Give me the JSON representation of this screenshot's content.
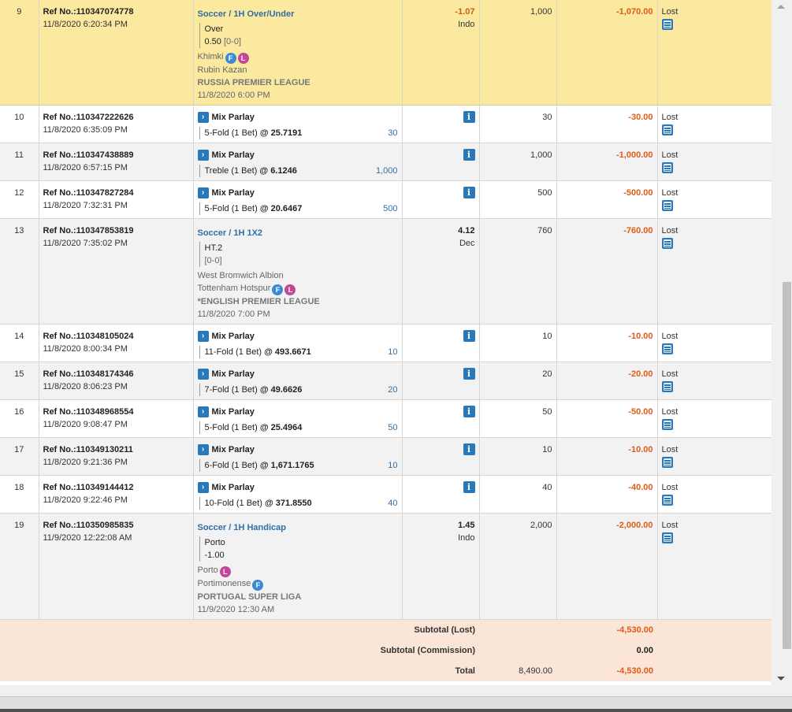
{
  "rows": [
    {
      "no": "9",
      "ref": "Ref No.:110347074778",
      "datetime": "11/8/2020 6:20:34 PM",
      "type": "single",
      "sport": "Soccer / 1H Over/Under",
      "selection": "Over",
      "line": "0.50",
      "score": "[0-0]",
      "home": "Khimki",
      "home_badges": [
        "F",
        "L"
      ],
      "away": "Rubin Kazan",
      "away_badges": [],
      "league": "RUSSIA PREMIER LEAGUE",
      "match_date": "11/8/2020 6:00 PM",
      "odds": "-1.07",
      "odds_type": "Indo",
      "stake": "1,000",
      "winloss": "-1,070.00",
      "status": "Lost",
      "highlight": true
    },
    {
      "no": "10",
      "ref": "Ref No.:110347222626",
      "datetime": "11/8/2020 6:35:09 PM",
      "type": "parlay",
      "parlay_title": "Mix Parlay",
      "fold": "5-Fold (1 Bet)",
      "at": "@ 25.7191",
      "parlay_stake": "30",
      "stake": "30",
      "winloss": "-30.00",
      "status": "Lost"
    },
    {
      "no": "11",
      "ref": "Ref No.:110347438889",
      "datetime": "11/8/2020 6:57:15 PM",
      "type": "parlay",
      "parlay_title": "Mix Parlay",
      "fold": "Treble (1 Bet)",
      "at": "@ 6.1246",
      "parlay_stake": "1,000",
      "stake": "1,000",
      "winloss": "-1,000.00",
      "status": "Lost"
    },
    {
      "no": "12",
      "ref": "Ref No.:110347827284",
      "datetime": "11/8/2020 7:32:31 PM",
      "type": "parlay",
      "parlay_title": "Mix Parlay",
      "fold": "5-Fold (1 Bet)",
      "at": "@ 20.6467",
      "parlay_stake": "500",
      "stake": "500",
      "winloss": "-500.00",
      "status": "Lost"
    },
    {
      "no": "13",
      "ref": "Ref No.:110347853819",
      "datetime": "11/8/2020 7:35:02 PM",
      "type": "single",
      "sport": "Soccer / 1H 1X2",
      "selection": "HT.2",
      "line": "",
      "score": "[0-0]",
      "home": "West Bromwich Albion",
      "home_badges": [],
      "away": "Tottenham Hotspur",
      "away_badges": [
        "F",
        "L"
      ],
      "league": "*ENGLISH PREMIER LEAGUE",
      "match_date": "11/8/2020 7:00 PM",
      "odds": "4.12",
      "odds_type": "Dec",
      "stake": "760",
      "winloss": "-760.00",
      "status": "Lost"
    },
    {
      "no": "14",
      "ref": "Ref No.:110348105024",
      "datetime": "11/8/2020 8:00:34 PM",
      "type": "parlay",
      "parlay_title": "Mix Parlay",
      "fold": "11-Fold (1 Bet)",
      "at": "@ 493.6671",
      "parlay_stake": "10",
      "stake": "10",
      "winloss": "-10.00",
      "status": "Lost"
    },
    {
      "no": "15",
      "ref": "Ref No.:110348174346",
      "datetime": "11/8/2020 8:06:23 PM",
      "type": "parlay",
      "parlay_title": "Mix Parlay",
      "fold": "7-Fold (1 Bet)",
      "at": "@ 49.6626",
      "parlay_stake": "20",
      "stake": "20",
      "winloss": "-20.00",
      "status": "Lost"
    },
    {
      "no": "16",
      "ref": "Ref No.:110348968554",
      "datetime": "11/8/2020 9:08:47 PM",
      "type": "parlay",
      "parlay_title": "Mix Parlay",
      "fold": "5-Fold (1 Bet)",
      "at": "@ 25.4964",
      "parlay_stake": "50",
      "stake": "50",
      "winloss": "-50.00",
      "status": "Lost"
    },
    {
      "no": "17",
      "ref": "Ref No.:110349130211",
      "datetime": "11/8/2020 9:21:36 PM",
      "type": "parlay",
      "parlay_title": "Mix Parlay",
      "fold": "6-Fold (1 Bet)",
      "at": "@ 1,671.1765",
      "parlay_stake": "10",
      "stake": "10",
      "winloss": "-10.00",
      "status": "Lost"
    },
    {
      "no": "18",
      "ref": "Ref No.:110349144412",
      "datetime": "11/8/2020 9:22:46 PM",
      "type": "parlay",
      "parlay_title": "Mix Parlay",
      "fold": "10-Fold (1 Bet)",
      "at": "@ 371.8550",
      "parlay_stake": "40",
      "stake": "40",
      "winloss": "-40.00",
      "status": "Lost"
    },
    {
      "no": "19",
      "ref": "Ref No.:110350985835",
      "datetime": "11/9/2020 12:22:08 AM",
      "type": "single",
      "sport": "Soccer / 1H Handicap",
      "selection": "Porto",
      "line": "-1.00",
      "score": "",
      "home": "Porto",
      "home_badges": [
        "L"
      ],
      "away": "Portimonense",
      "away_badges": [
        "F"
      ],
      "league": "PORTUGAL SUPER LIGA",
      "match_date": "11/9/2020 12:30 AM",
      "odds": "1.45",
      "odds_type": "Indo",
      "stake": "2,000",
      "winloss": "-2,000.00",
      "status": "Lost"
    }
  ],
  "summary": {
    "subtotal_lost_label": "Subtotal (Lost)",
    "subtotal_lost_value": "-4,530.00",
    "subtotal_commission_label": "Subtotal (Commission)",
    "subtotal_commission_value": "0.00",
    "total_label": "Total",
    "total_stake": "8,490.00",
    "total_value": "-4,530.00"
  },
  "icons": {
    "info": "info-icon",
    "receipt": "receipt-icon",
    "expand": "chevron-right-icon",
    "badge_f": "F",
    "badge_l": "L"
  },
  "colors": {
    "highlight_row": "#fbe9a0",
    "summary_bg": "#fbe5d6",
    "loss_text": "#e05a16",
    "link_blue": "#2f6ea8",
    "icon_blue": "#2b78b8",
    "badge_f": "#3a8ad6",
    "badge_l": "#c2479a"
  }
}
